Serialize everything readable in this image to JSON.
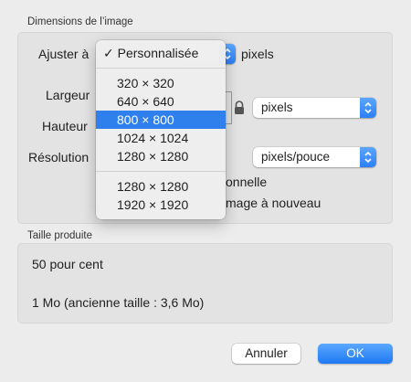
{
  "dimensions": {
    "title": "Dimensions de l’image",
    "fit_label": "Ajuster à",
    "fit_units": "pixels",
    "width_label": "Largeur",
    "height_label": "Hauteur",
    "resolution_label": "Résolution",
    "size_units": "pixels",
    "resolution_units": "pixels/pouce",
    "proportional_partial": "onnelle",
    "resample_partial": "mage à nouveau"
  },
  "menu": {
    "checked_item": "Personnalisée",
    "check_mark": "✓",
    "group1": [
      "320 × 320",
      "640 × 640",
      "800 × 800",
      "1024 × 1024",
      "1280 × 1280"
    ],
    "group2": [
      "1280 × 1280",
      "1920 × 1920"
    ],
    "highlighted": "800 × 800"
  },
  "output": {
    "title": "Taille produite",
    "percent": "50 pour cent",
    "size": "1 Mo (ancienne taille : 3,6 Mo)"
  },
  "buttons": {
    "cancel": "Annuler",
    "ok": "OK"
  },
  "colors": {
    "accent": "#2f80ed",
    "background": "#ececec"
  }
}
